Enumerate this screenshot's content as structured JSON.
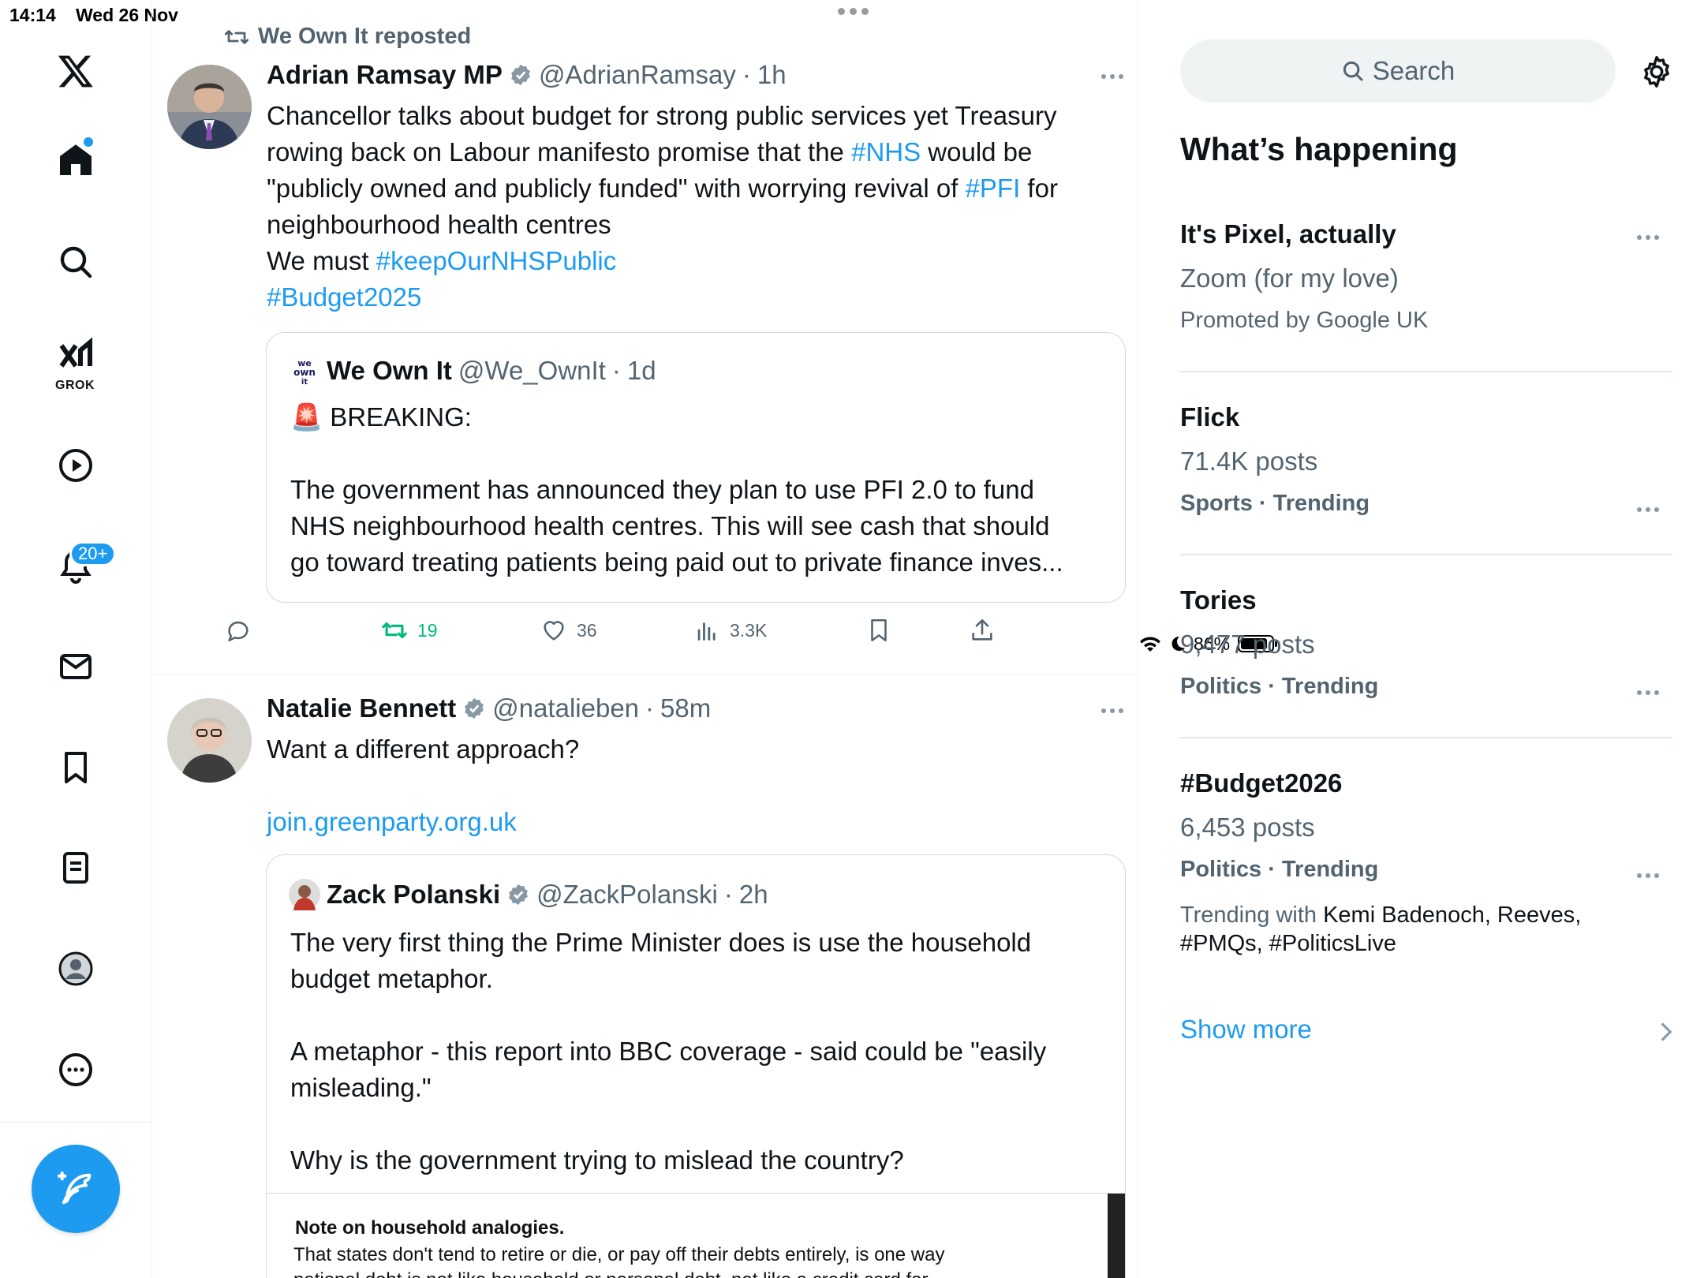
{
  "status_bar": {
    "time": "14:14",
    "date": "Wed 26 Nov",
    "battery": "86%"
  },
  "nav": {
    "grok_label": "GROK",
    "notifications_badge": "20+"
  },
  "tweets": [
    {
      "repost_label": "We Own It reposted",
      "name": "Adrian Ramsay MP",
      "handle": "@AdrianRamsay",
      "sep": "·",
      "time": "1h",
      "text": {
        "l1": "Chancellor talks about budget for strong public services yet Treasury",
        "l2a": "rowing back on Labour manifesto promise that the ",
        "l2_tag": "#NHS",
        "l2b": " would be",
        "l3a": "\"publicly owned and publicly funded\" with worrying revival of ",
        "l3_tag": "#PFI",
        "l3b": " for",
        "l4": "neighbourhood health centres",
        "l5a": "We must ",
        "l5_tag": "#keepOurNHSPublic",
        "l6_tag": "#Budget2025"
      },
      "quote": {
        "name": "We Own It",
        "handle": "@We_OwnIt",
        "sep": "·",
        "time": "1d",
        "l1": "🚨 BREAKING:",
        "l2": "The government has announced they plan to use PFI 2.0 to fund",
        "l3": "NHS neighbourhood health centres. This will see cash that should",
        "l4": "go toward treating patients being paid out to private finance inves..."
      },
      "actions": {
        "reposts": "19",
        "likes": "36",
        "views": "3.3K"
      }
    },
    {
      "name": "Natalie Bennett",
      "handle": "@natalieben",
      "sep": "·",
      "time": "58m",
      "text": "Want a different approach?",
      "link": "join.greenparty.org.uk",
      "quote": {
        "name": "Zack Polanski",
        "handle": "@ZackPolanski",
        "sep": "·",
        "time": "2h",
        "l1": "The very first thing the Prime Minister does is use the household",
        "l2": "budget metaphor.",
        "l3": "A metaphor - this report into BBC coverage - said could be \"easily",
        "l4": "misleading.\"",
        "l5": "Why is the government trying to mislead the country?",
        "doc_title": "Note on household analogies.",
        "doc_l1": "That states don't tend to retire or die, or pay off their debts entirely, is one way",
        "doc_l2": "national debt is not like household or personal debt, not like a credit card for"
      }
    }
  ],
  "sidebar": {
    "search_placeholder": "Search",
    "section_title": "What’s happening",
    "trends": [
      {
        "title": "It's Pixel, actually",
        "sub": "Zoom (for my love)",
        "promo": "Promoted by Google UK"
      },
      {
        "title": "Flick",
        "sub": "71.4K posts",
        "category": "Sports · Trending"
      },
      {
        "title": "Tories",
        "sub": "9,477 posts",
        "category": "Politics · Trending"
      },
      {
        "title": "#Budget2026",
        "sub": "6,453 posts",
        "category": "Politics · Trending",
        "with_label": "Trending with ",
        "with_names_1": "Kemi Badenoch, Reeves,",
        "with_names_2": "#PMQs, #PoliticsLive"
      }
    ],
    "show_more": "Show more"
  },
  "colors": {
    "accent": "#1d9bf0",
    "repost_green": "#00ba7c",
    "text": "#0f1419",
    "muted": "#536471"
  }
}
